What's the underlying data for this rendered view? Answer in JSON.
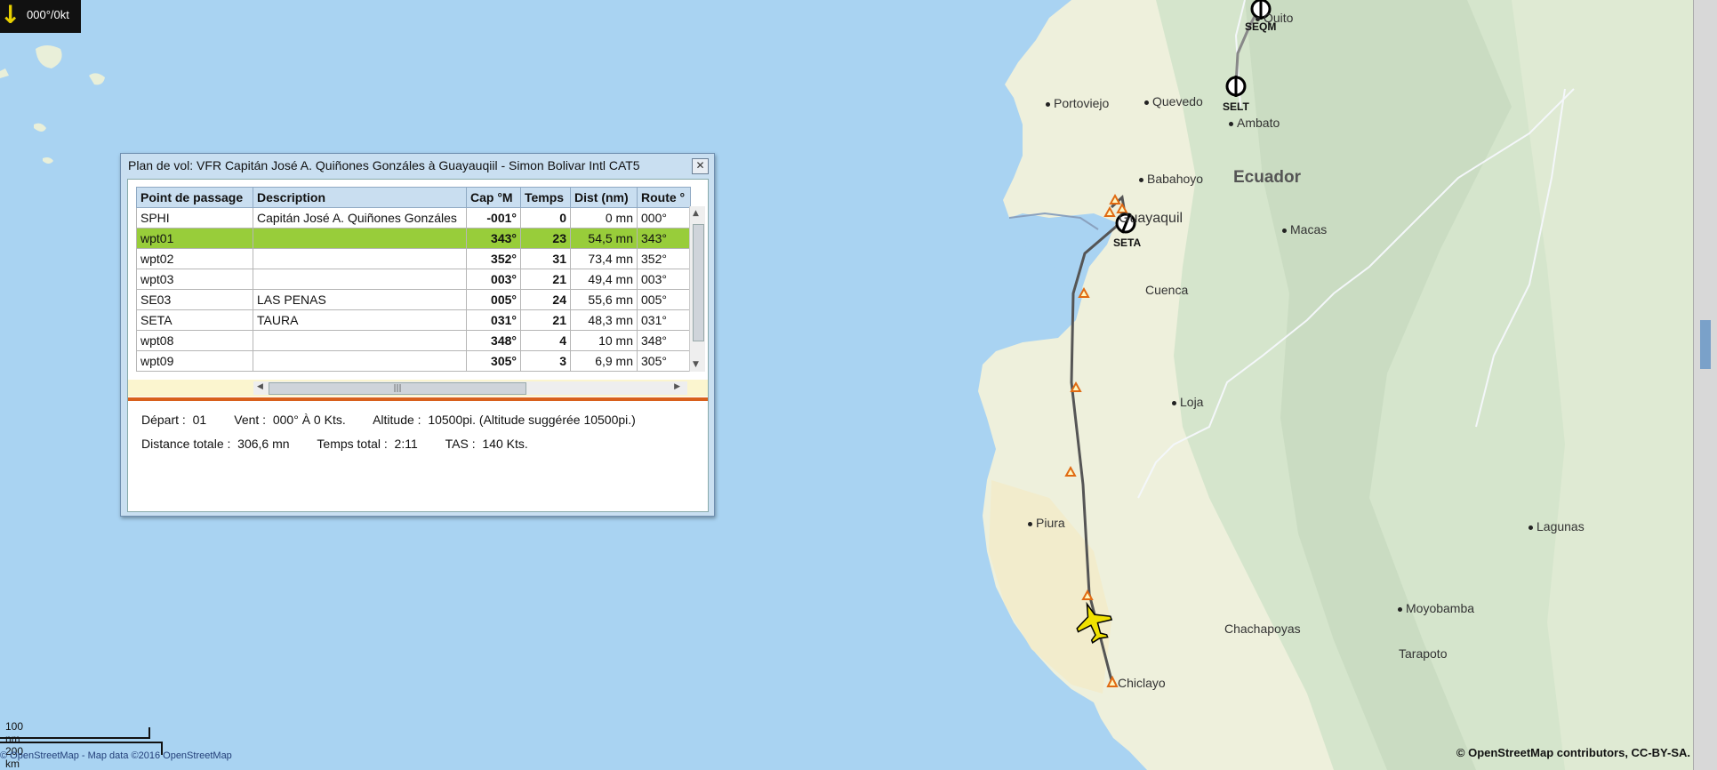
{
  "wind": {
    "text": "000°/0kt",
    "arrow": "↓"
  },
  "map": {
    "places": [
      {
        "name": "Portoviejo",
        "dot": true
      },
      {
        "name": "Quevedo",
        "dot": true
      },
      {
        "name": "Ambato",
        "dot": true
      },
      {
        "name": "Babahoyo",
        "dot": true
      },
      {
        "name": "Macas",
        "dot": true
      },
      {
        "name": "Cuenca",
        "dot": true
      },
      {
        "name": "Loja",
        "dot": true
      },
      {
        "name": "Piura",
        "dot": true
      },
      {
        "name": "Lagunas",
        "dot": true
      },
      {
        "name": "Moyobamba",
        "dot": true
      },
      {
        "name": "Chachapoyas",
        "dot": true
      },
      {
        "name": "Tarapoto",
        "dot": true
      },
      {
        "name": "Chiclayo",
        "dot": false
      },
      {
        "name": "Quito",
        "dot": true
      },
      {
        "name": "Guayaquil",
        "dot": false
      }
    ],
    "country": "Ecuador",
    "waypoint_labels": [
      "SEQM",
      "SELT",
      "SETA"
    ],
    "scale": {
      "nm": "100 nm",
      "km": "200 km"
    },
    "attribution_left": "© OpenStreetMap - Map data ©2016 OpenStreetMap",
    "attribution_right": "© OpenStreetMap contributors, CC-BY-SA."
  },
  "dialog": {
    "title": "Plan de vol: VFR Capitán José A. Quiñones Gonzáles à Guayauqiil - Simon Bolivar Intl  CAT5",
    "close_icon": "close-icon",
    "columns": [
      "Point de passage",
      "Description",
      "Cap °M",
      "Temps",
      "Dist (nm)",
      "Route °"
    ],
    "rows": [
      {
        "point": "SPHI",
        "desc": "Capitán José A. Quiñones Gonzáles",
        "cap": "-001°",
        "temps": "0",
        "dist": "0 mn",
        "route": "000°"
      },
      {
        "point": "wpt01",
        "desc": "",
        "cap": "343°",
        "temps": "23",
        "dist": "54,5 mn",
        "route": "343°"
      },
      {
        "point": "wpt02",
        "desc": "",
        "cap": "352°",
        "temps": "31",
        "dist": "73,4 mn",
        "route": "352°"
      },
      {
        "point": "wpt03",
        "desc": "",
        "cap": "003°",
        "temps": "21",
        "dist": "49,4 mn",
        "route": "003°"
      },
      {
        "point": "SE03",
        "desc": "LAS PENAS",
        "cap": "005°",
        "temps": "24",
        "dist": "55,6 mn",
        "route": "005°"
      },
      {
        "point": "SETA",
        "desc": "TAURA",
        "cap": "031°",
        "temps": "21",
        "dist": "48,3 mn",
        "route": "031°"
      },
      {
        "point": "wpt08",
        "desc": "",
        "cap": "348°",
        "temps": "4",
        "dist": "10 mn",
        "route": "348°"
      },
      {
        "point": "wpt09",
        "desc": "",
        "cap": "305°",
        "temps": "3",
        "dist": "6,9 mn",
        "route": "305°"
      }
    ],
    "selected_row": 1,
    "info": {
      "line1": "Départ :  01        Vent :  000° À 0 Kts.        Altitude :  10500pi. (Altitude suggérée 10500pi.)",
      "line2": "Distance totale :  306,6 mn        Temps total :  2:11        TAS :  140 Kts."
    }
  },
  "colors": {
    "sea": "#a9d3f2",
    "selected_row": "#98cd3a",
    "route": "#555555",
    "separator": "#d8601c"
  }
}
